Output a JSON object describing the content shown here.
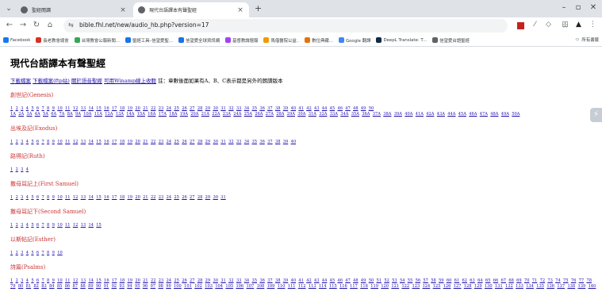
{
  "browser": {
    "tabs": [
      {
        "title": "聖經閱讀",
        "active": false
      },
      {
        "title": "現代台語譯本有聲聖經",
        "active": true
      }
    ],
    "url": "bible.fhl.net/new/audio_hb.php?version=17",
    "bookmarks": [
      {
        "label": "Facebook",
        "color": "#1877f2"
      },
      {
        "label": "長老教會總會",
        "color": "#d93025"
      },
      {
        "label": "台灣教會公報新聞...",
        "color": "#34a853"
      },
      {
        "label": "聖經工具–信望愛聖...",
        "color": "#1a73e8"
      },
      {
        "label": "信望愛全球資訊網",
        "color": "#1a73e8"
      },
      {
        "label": "基督教論壇報",
        "color": "#a142f4"
      },
      {
        "label": "馬偕醫院公益..",
        "color": "#f29900"
      },
      {
        "label": "數位典藏...",
        "color": "#e8710a"
      },
      {
        "label": "Google 翻譯",
        "color": "#4285f4"
      },
      {
        "label": "DeepL Translate: T...",
        "color": "#0f2b46"
      },
      {
        "label": "信望愛台語聖經",
        "color": "#5f6368"
      }
    ],
    "bookmarks_right": "所有書籤"
  },
  "page": {
    "title": "現代台語譯本有聲聖經",
    "links": [
      "下載檔案",
      "下載檔案(ftp站)",
      "關於語音聖經",
      "可用Winamp線上收聽"
    ],
    "note": "註：章數後面如果有A、B、C表示都是另外的朗讀版本",
    "books": [
      {
        "name": "創世記(Genesis)",
        "rows": [
          "1 2 3 4 5 6 7 8 9 10 11 12 13 14 15 16 17 18 19 20 21 22 23 24 25 26 27 28 29 30 31 32 33 34 35 36 37 38 39 40 41 42 43 44 45 46 47 48 49 50",
          "1A 2A 3A 4A 5A 6A 7A 8A 9A 10A 11A 12A 13A 14A 15A 16A 17A 18A 19A 20A 21A 22A 23A 24A 25A 26A 27A 28A 29A 30A 31A 32A 33A 34A 35A 36A 37A 38A 39A 40A 41A 42A 43A 44A 45A 46A 47A 48A 49A 50A"
        ]
      },
      {
        "name": "出埃及記(Exodus)",
        "rows": [
          "1 2 3 4 5 6 7 8 9 10 11 12 13 14 15 16 17 18 19 20 21 22 23 24 25 26 27 28 29 30 31 32 33 34 35 36 37 38 39 40"
        ]
      },
      {
        "name": "路得記(Ruth)",
        "rows": [
          "1 2 3 4"
        ]
      },
      {
        "name": "撒母耳記上(First Samuel)",
        "rows": [
          "1 2 3 4 5 6 7 8 9 10 11 12 13 14 15 16 17 18 19 20 21 22 23 24 25 26 27 28 29 30 31"
        ]
      },
      {
        "name": "撒母耳記下(Second Samuel)",
        "rows": [
          "1 2 3 4 5 6 7 8 9 10 11 12 13 14 15"
        ]
      },
      {
        "name": "以斯帖記(Esther)",
        "rows": [
          "1 2 3 4 5 6 7 8 9 10"
        ]
      },
      {
        "name": "詩篇(Psalms)",
        "rows": [
          "1 2 3 4 5 6 7 8 9 10 11 12 13 14 15 16 17 18 19 20 21 22 23 24 25 26 27 28 29 30 31 32 33 34 35 36 37 38 39 40 41 42 43 44 45 46 47 48 49 50 51 52 53 54 55 56 57 58 59 60 61 62 63 64 65 66 67 68 69 70 71 72 73 74 75 76 77 78",
          "79 80 81 82 83 84 85 86 87 88 89 90 91 92 93 94 95 96 97 98 99 100 101 102 103 104 105 106 107 108 109 110 111 112 113 114 115 116 117 118 119 120 121 122 123 124 125 126 127 128 129 130 131 132 133 134 135 136 137 138 139 140"
        ]
      }
    ]
  }
}
